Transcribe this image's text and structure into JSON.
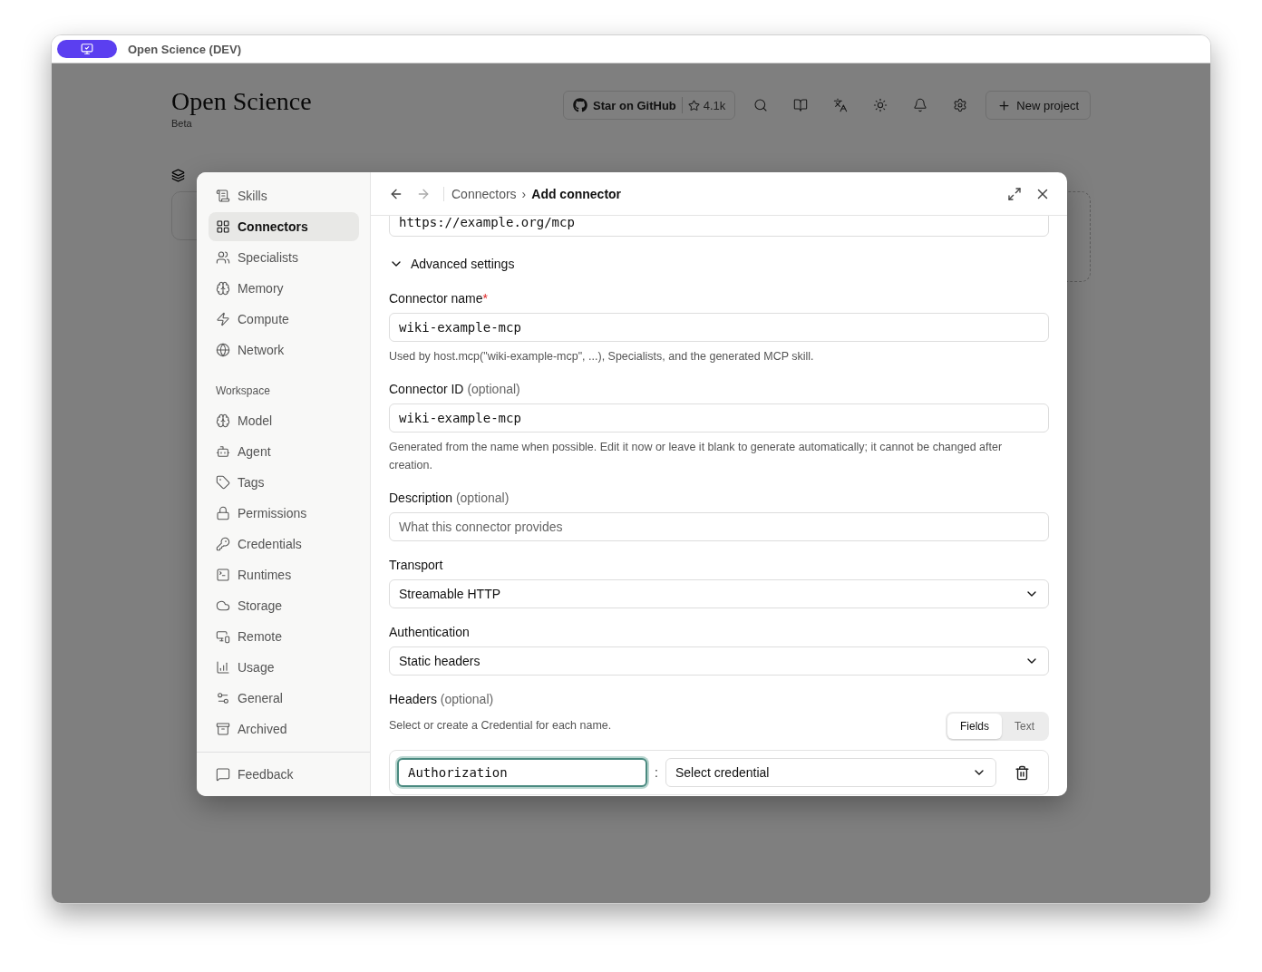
{
  "window": {
    "title": "Open Science (DEV)"
  },
  "app": {
    "title": "Open Science",
    "subtitle": "Beta",
    "github_label": "Star on GitHub",
    "stars": "4.1k",
    "new_project": "New project"
  },
  "sidebar": {
    "items": [
      {
        "label": "Skills",
        "selected": false
      },
      {
        "label": "Connectors",
        "selected": true
      },
      {
        "label": "Specialists",
        "selected": false
      },
      {
        "label": "Memory",
        "selected": false
      },
      {
        "label": "Compute",
        "selected": false
      },
      {
        "label": "Network",
        "selected": false
      }
    ],
    "group_title": "Workspace",
    "workspace_items": [
      {
        "label": "Model",
        "selected": false
      },
      {
        "label": "Agent",
        "selected": false
      },
      {
        "label": "Tags",
        "selected": false
      },
      {
        "label": "Permissions",
        "selected": false
      },
      {
        "label": "Credentials",
        "selected": false
      },
      {
        "label": "Runtimes",
        "selected": false
      },
      {
        "label": "Storage",
        "selected": false
      },
      {
        "label": "Remote",
        "selected": false
      },
      {
        "label": "Usage",
        "selected": false
      },
      {
        "label": "General",
        "selected": false
      },
      {
        "label": "Archived",
        "selected": false
      }
    ],
    "footer": "Feedback"
  },
  "breadcrumb": [
    "Connectors",
    "›",
    "Add connector"
  ],
  "form": {
    "url": "https://example.org/mcp",
    "advanced": {
      "label": "Advanced settings",
      "expanded": true
    },
    "fields": [
      {
        "kind": "input",
        "label": "Connector name",
        "required_mark": "*",
        "value": "wiki-example-mcp",
        "help": "Used by host.mcp(\"wiki-example-mcp\", ...), Specialists, and the generated MCP skill."
      },
      {
        "kind": "input",
        "label": "Connector ID",
        "optional": "(optional)",
        "value": "wiki-example-mcp",
        "help": "Generated from the name when possible. Edit it now or leave it blank to generate automatically; it cannot be changed after creation."
      },
      {
        "kind": "input",
        "label": "Description",
        "optional": "(optional)",
        "placeholder": "What this connector provides"
      },
      {
        "kind": "select",
        "label": "Transport",
        "value": "Streamable HTTP"
      },
      {
        "kind": "select",
        "label": "Authentication",
        "value": "Static headers"
      }
    ],
    "headers": {
      "label": "Headers",
      "optional": "(optional)",
      "help": "Select or create a Credential for each name.",
      "modes": [
        {
          "label": "Fields",
          "selected": true
        },
        {
          "label": "Text",
          "selected": false
        }
      ],
      "rows": [
        {
          "name": "Authorization",
          "separator": ":",
          "credential": "Select credential"
        }
      ]
    }
  }
}
